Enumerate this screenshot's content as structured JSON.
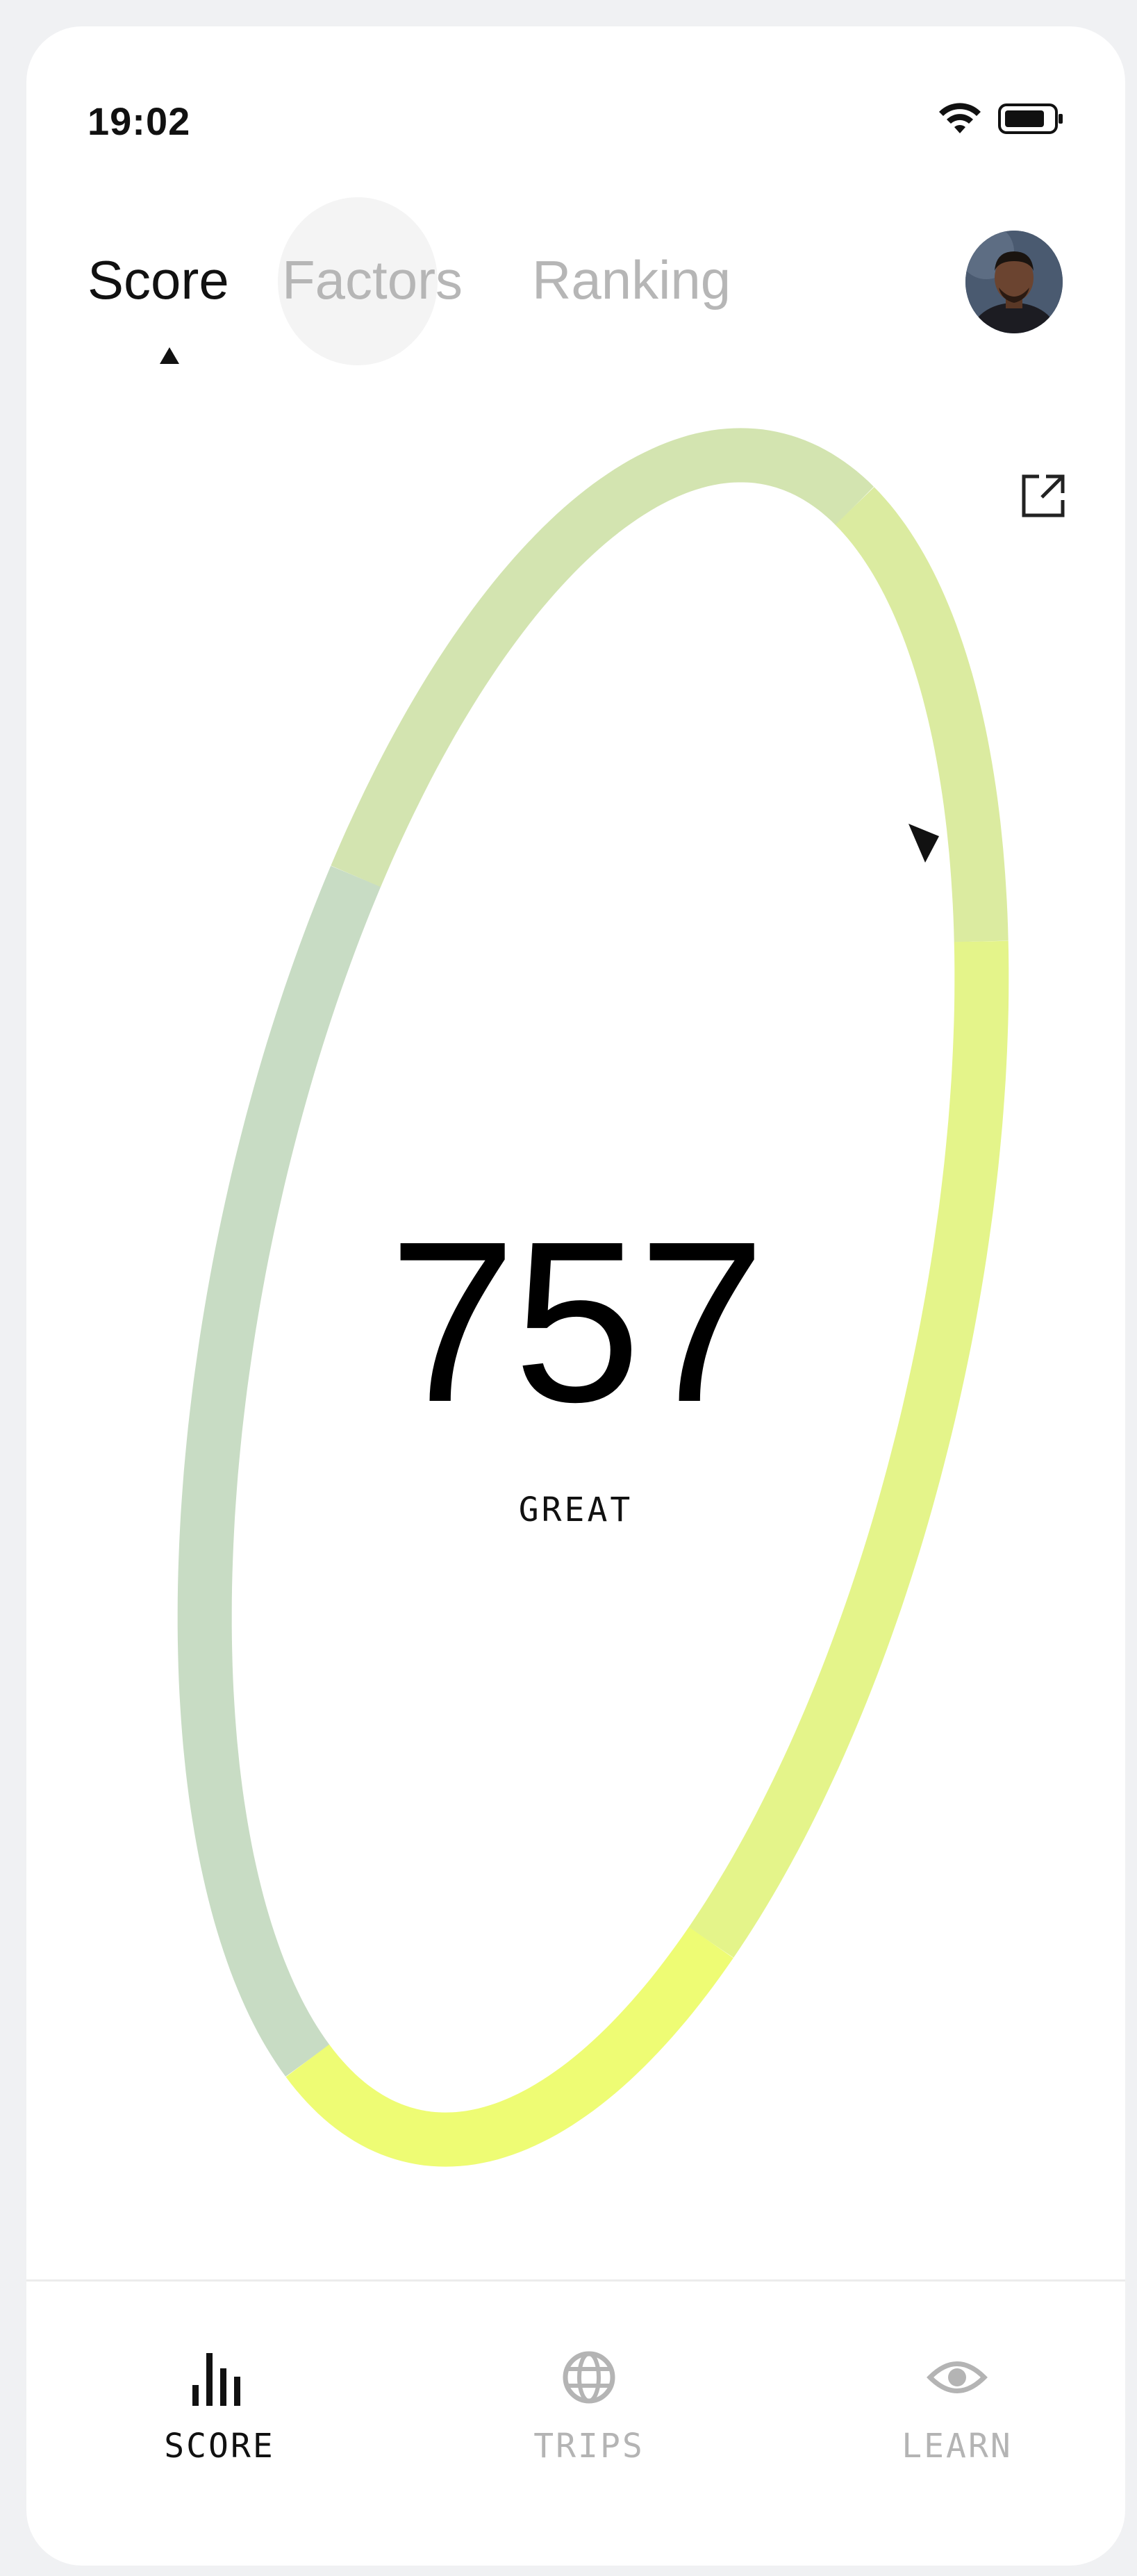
{
  "status_bar": {
    "time": "19:02",
    "icons": [
      "wifi-icon",
      "battery-icon"
    ]
  },
  "tabs": [
    {
      "label": "Score",
      "active": true
    },
    {
      "label": "Factors",
      "active": false
    },
    {
      "label": "Ranking",
      "active": false
    }
  ],
  "avatar": {
    "icon": "user-avatar"
  },
  "share": {
    "icon": "external-link-icon"
  },
  "score": {
    "value": "757",
    "rating": "GREAT",
    "ring_colors": [
      "#c8dcc4",
      "#d3e4b0",
      "#dbeba0",
      "#e4f48a",
      "#eefc74"
    ]
  },
  "bottom_nav": [
    {
      "label": "SCORE",
      "icon": "bar-chart-icon",
      "active": true
    },
    {
      "label": "TRIPS",
      "icon": "globe-icon",
      "active": false
    },
    {
      "label": "LEARN",
      "icon": "eye-icon",
      "active": false
    }
  ],
  "colors": {
    "active_text": "#111111",
    "inactive_text": "#b4b4b4",
    "background": "#ffffff"
  }
}
